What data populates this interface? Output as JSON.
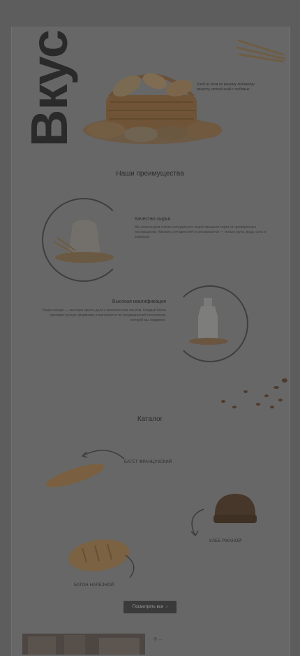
{
  "hero": {
    "title": "Вкус",
    "note": "Хлеб из печи по вашему любимому рецепту, испечённый с любовью"
  },
  "advantages": {
    "title": "Наши преимущества",
    "items": [
      {
        "title": "Качество сырья",
        "description": "Мы используем только натуральное сырьё высшего сорта от проверенных поставщиков. Никаких улучшителей и консервантов — только мука, вода, соль и закваска."
      },
      {
        "title": "Высокая квалификация",
        "description": "Наши пекари — мастера своего дела с многолетним опытом. Каждый батон проходит ручную формовку и выпекается по традиционной технологии, которой мы гордимся."
      }
    ]
  },
  "catalog": {
    "title": "Каталог",
    "items": [
      {
        "caption": "БАГЕТ ФРАНЦУЗСКИЙ"
      },
      {
        "caption": "ХЛЕБ РЖАНОЙ"
      },
      {
        "caption": "БАТОН НАРЕЗНОЙ"
      }
    ],
    "more_button": "Посмотреть все"
  },
  "footer": {
    "line": "◎ …"
  },
  "colors": {
    "overlay": "#5d5d5d",
    "page": "#676767",
    "text": "#262626",
    "button": "#3a3a3a"
  }
}
